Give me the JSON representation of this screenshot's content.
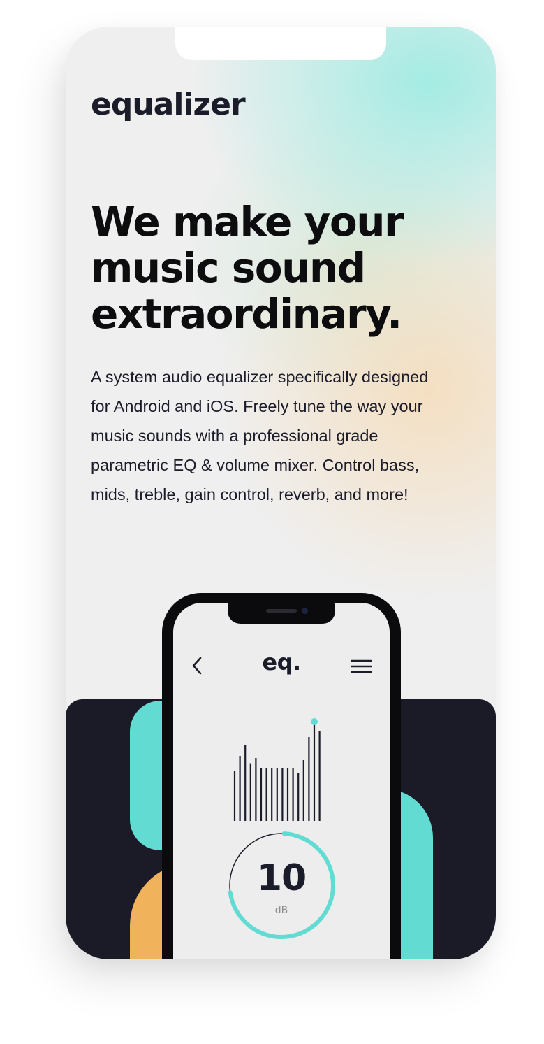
{
  "brand": {
    "logo_text": "equalizer"
  },
  "hero": {
    "headline_lines": [
      "We make your",
      "music sound",
      "extraordinary."
    ],
    "description_lines": [
      "A system audio equalizer specifically designed",
      "for Android and iOS. Freely tune the way your",
      "music sounds with a professional grade",
      "parametric EQ & volume mixer. Control bass,",
      "mids, treble, gain control, reverb, and more!"
    ]
  },
  "app_mockup": {
    "title": "eq.",
    "gain": {
      "value": "10",
      "unit": "dB",
      "fill_fraction": 0.72
    },
    "eq_bar_levels": [
      0.48,
      0.62,
      0.72,
      0.55,
      0.6,
      0.5,
      0.5,
      0.5,
      0.5,
      0.5,
      0.5,
      0.5,
      0.46,
      0.58,
      0.8,
      0.92,
      0.86
    ],
    "icons": {
      "back": "back-chevron-icon",
      "menu": "hamburger-menu-icon"
    }
  },
  "colors": {
    "dark": "#1b1b28",
    "teal": "#62dcd3",
    "orange": "#f0b35c",
    "text": "#1b1c2a"
  }
}
